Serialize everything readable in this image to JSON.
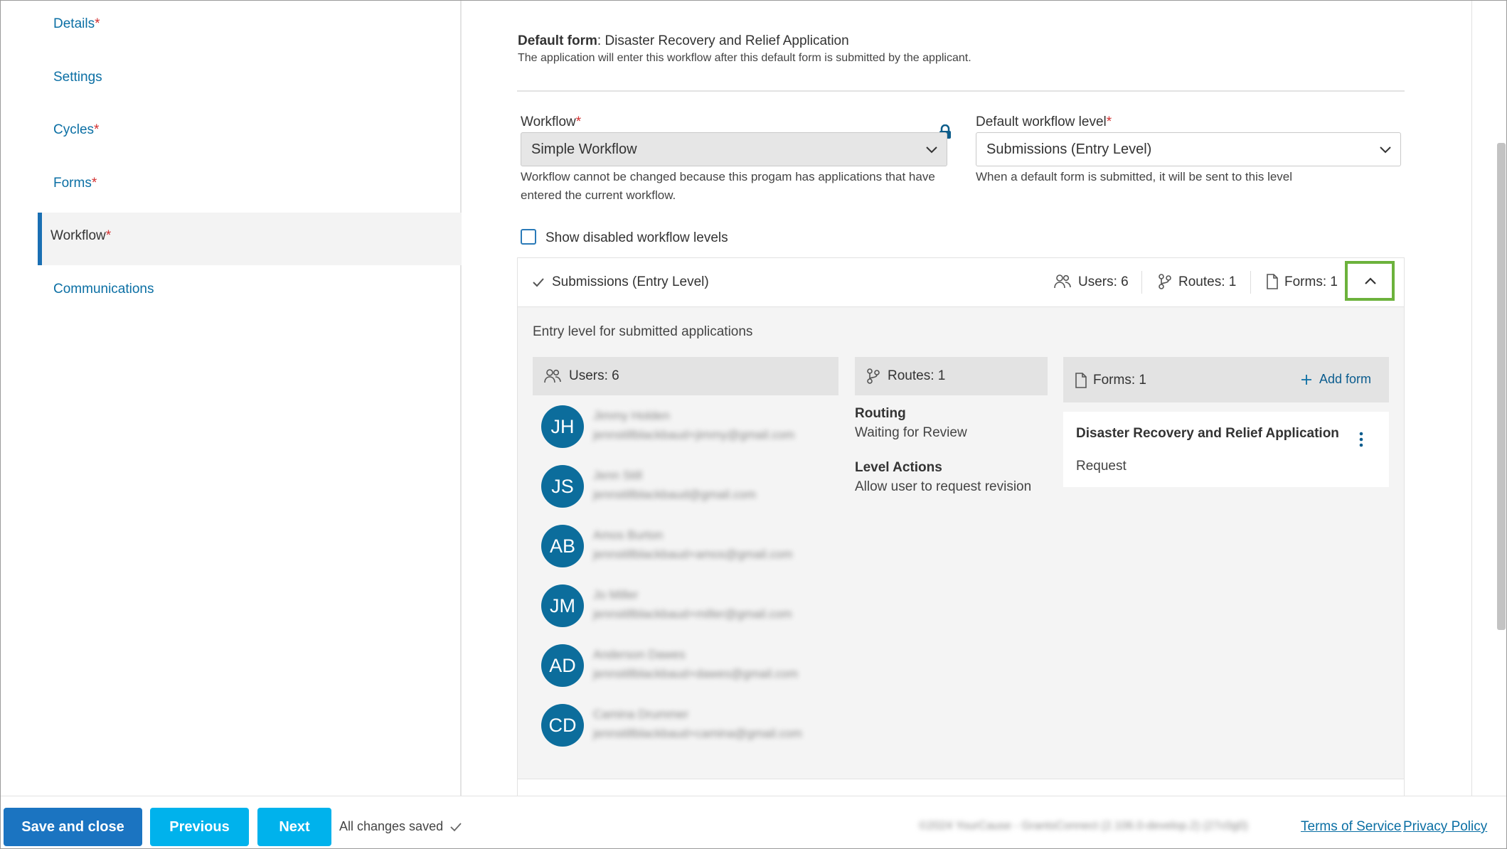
{
  "sidebar": {
    "items": [
      {
        "label": "Details",
        "required": "*"
      },
      {
        "label": "Settings",
        "required": ""
      },
      {
        "label": "Cycles",
        "required": "*"
      },
      {
        "label": "Forms",
        "required": "*"
      },
      {
        "label": "Workflow",
        "required": "*"
      },
      {
        "label": "Communications",
        "required": ""
      }
    ]
  },
  "default_form": {
    "label": "Default form",
    "value": ": Disaster Recovery and Relief Application",
    "description": "The application will enter this workflow after this default form is submitted by the applicant."
  },
  "workflow_field": {
    "label": "Workflow",
    "required": "*",
    "value": "Simple Workflow",
    "help_line1": "Workflow cannot be changed because this progam has applications that have",
    "help_line2": "entered the current workflow."
  },
  "default_level_field": {
    "label": "Default workflow level",
    "required": "*",
    "value": "Submissions (Entry Level)",
    "help": "When a default form is submitted, it will be sent to this level"
  },
  "show_disabled": {
    "label": "Show disabled workflow levels",
    "checked": false
  },
  "level": {
    "name": "Submissions (Entry Level)",
    "users_summary": "Users: 6",
    "routes_summary": "Routes: 1",
    "forms_summary": "Forms: 1",
    "description": "Entry level for submitted applications",
    "users_header": "Users: 6",
    "routes_header": "Routes: 1",
    "forms_header": "Forms: 1",
    "add_form": "Add form",
    "routing_label": "Routing",
    "routing_value": "Waiting for Review",
    "actions_label": "Level Actions",
    "actions_value": "Allow user to request revision",
    "users": [
      {
        "initials": "JH",
        "name": "Jimmy Holden",
        "email": "jennstillblackbaud+jimmy@gmail.com"
      },
      {
        "initials": "JS",
        "name": "Jenn Still",
        "email": "jennstillblackbaud@gmail.com"
      },
      {
        "initials": "AB",
        "name": "Amos Burton",
        "email": "jennstillblackbaud+amos@gmail.com"
      },
      {
        "initials": "JM",
        "name": "Jo Miller",
        "email": "jennstillblackbaud+miller@gmail.com"
      },
      {
        "initials": "AD",
        "name": "Anderson Dawes",
        "email": "jennstillblackbaud+dawes@gmail.com"
      },
      {
        "initials": "CD",
        "name": "Camina Drummer",
        "email": "jennstillblackbaud+camina@gmail.com"
      }
    ],
    "form_card": {
      "title": "Disaster Recovery and Relief Application",
      "type": "Request"
    }
  },
  "footer": {
    "save_close": "Save and close",
    "previous": "Previous",
    "next": "Next",
    "status": "All changes saved",
    "copyright": "©2024 YourCause - GrantsConnect (2.106.0-develop.2) (27c0g0)",
    "terms": "Terms of Service",
    "privacy": "Privacy Policy"
  },
  "colors": {
    "accent": "#0c6d9c",
    "primary_button": "#1b74c1",
    "secondary_button": "#00b2ec",
    "highlight": "#6cb23c",
    "required": "#d32f2f"
  }
}
